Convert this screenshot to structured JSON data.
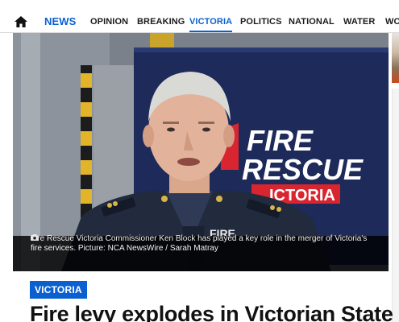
{
  "nav": {
    "items": [
      {
        "label": "NEWS"
      },
      {
        "label": "OPINION"
      },
      {
        "label": "BREAKING"
      },
      {
        "label": "VICTORIA"
      },
      {
        "label": "POLITICS"
      },
      {
        "label": "NATIONAL"
      },
      {
        "label": "WATER"
      },
      {
        "label": "WO"
      }
    ],
    "active": "VICTORIA",
    "accent_color": "#0b60d1"
  },
  "hero": {
    "backdrop": {
      "line1": "FIRE",
      "line2": "RESCUE",
      "line3": "ICTORIA"
    },
    "uniform_label": "FIRE",
    "caption": "Fire Rescue Victoria Commissioner Ken Block has played a key role in the merger of Victoria's fire services. Picture: NCA NewsWire / Sarah Matray"
  },
  "article": {
    "category": "VICTORIA",
    "headline": "Fire levy explodes in Victorian State"
  },
  "icons": {
    "home": "home-icon",
    "camera": "camera-icon"
  }
}
